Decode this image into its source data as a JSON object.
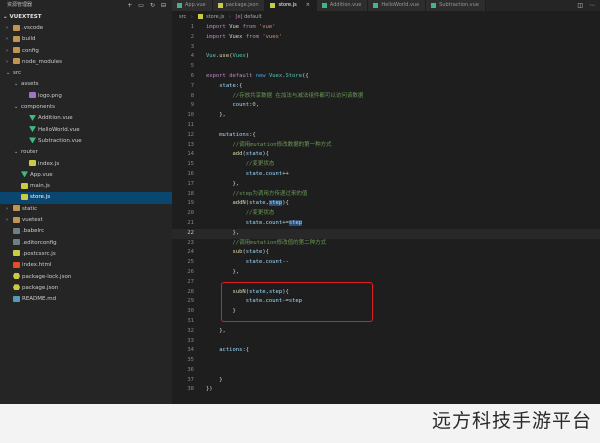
{
  "sidebar": {
    "title": "资源管理器",
    "project": "VUEXTEST",
    "tree": [
      {
        "label": ".vscode",
        "indent": 1,
        "arrow": "›",
        "icon": "folder"
      },
      {
        "label": "build",
        "indent": 1,
        "arrow": "›",
        "icon": "folder"
      },
      {
        "label": "config",
        "indent": 1,
        "arrow": "›",
        "icon": "folder"
      },
      {
        "label": "node_modules",
        "indent": 1,
        "arrow": "›",
        "icon": "folder"
      },
      {
        "label": "src",
        "indent": 1,
        "arrow": "⌄",
        "icon": "none"
      },
      {
        "label": "assets",
        "indent": 2,
        "arrow": "⌄",
        "icon": "none"
      },
      {
        "label": "logo.png",
        "indent": 3,
        "arrow": "",
        "icon": "img"
      },
      {
        "label": "components",
        "indent": 2,
        "arrow": "⌄",
        "icon": "none"
      },
      {
        "label": "Addition.vue",
        "indent": 3,
        "arrow": "",
        "icon": "vue"
      },
      {
        "label": "HelloWorld.vue",
        "indent": 3,
        "arrow": "",
        "icon": "vue"
      },
      {
        "label": "Subtraction.vue",
        "indent": 3,
        "arrow": "",
        "icon": "vue"
      },
      {
        "label": "router",
        "indent": 2,
        "arrow": "⌄",
        "icon": "none"
      },
      {
        "label": "index.js",
        "indent": 3,
        "arrow": "",
        "icon": "js"
      },
      {
        "label": "App.vue",
        "indent": 2,
        "arrow": "",
        "icon": "vue"
      },
      {
        "label": "main.js",
        "indent": 2,
        "arrow": "",
        "icon": "js"
      },
      {
        "label": "store.js",
        "indent": 2,
        "arrow": "",
        "icon": "js",
        "selected": true
      },
      {
        "label": "static",
        "indent": 1,
        "arrow": "›",
        "icon": "folder"
      },
      {
        "label": "vuetest",
        "indent": 1,
        "arrow": "›",
        "icon": "folder"
      },
      {
        "label": ".babelrc",
        "indent": 1,
        "arrow": "",
        "icon": "cfg"
      },
      {
        "label": ".editorconfig",
        "indent": 1,
        "arrow": "",
        "icon": "cfg"
      },
      {
        "label": ".postcssrc.js",
        "indent": 1,
        "arrow": "",
        "icon": "js"
      },
      {
        "label": "index.html",
        "indent": 1,
        "arrow": "",
        "icon": "git"
      },
      {
        "label": "package-lock.json",
        "indent": 1,
        "arrow": "",
        "icon": "json"
      },
      {
        "label": "package.json",
        "indent": 1,
        "arrow": "",
        "icon": "json"
      },
      {
        "label": "README.md",
        "indent": 1,
        "arrow": "",
        "icon": "md"
      }
    ]
  },
  "tabs": [
    {
      "label": "App.vue",
      "icon": "vue"
    },
    {
      "label": "package.json",
      "icon": "json"
    },
    {
      "label": "store.js",
      "icon": "js",
      "active": true
    },
    {
      "label": "Addition.vue",
      "icon": "vue"
    },
    {
      "label": "HelloWorld.vue",
      "icon": "vue"
    },
    {
      "label": "Subtraction.vue",
      "icon": "vue"
    }
  ],
  "breadcrumb": [
    "src",
    "store.js",
    "default"
  ],
  "code": {
    "current_line": 22,
    "lines": [
      [
        [
          "kw",
          "import "
        ],
        [
          "pn",
          "Vue "
        ],
        [
          "kw",
          "from "
        ],
        [
          "str",
          "'vue'"
        ]
      ],
      [
        [
          "kw",
          "import "
        ],
        [
          "pn",
          "Vuex "
        ],
        [
          "kw",
          "from "
        ],
        [
          "str",
          "'vuex'"
        ]
      ],
      [],
      [
        [
          "cls",
          "Vue"
        ],
        [
          "pn",
          "."
        ],
        [
          "fn",
          "use"
        ],
        [
          "pn",
          "("
        ],
        [
          "cls",
          "Vuex"
        ],
        [
          "pn",
          ")"
        ]
      ],
      [],
      [
        [
          "kw",
          "export "
        ],
        [
          "kw",
          "default "
        ],
        [
          "kb",
          "new "
        ],
        [
          "cls",
          "Vuex"
        ],
        [
          "pn",
          "."
        ],
        [
          "cls",
          "Store"
        ],
        [
          "pn",
          "({"
        ]
      ],
      [
        [
          "pn",
          "    "
        ],
        [
          "var",
          "state"
        ],
        [
          "pn",
          ":{"
        ]
      ],
      [
        [
          "pn",
          "        "
        ],
        [
          "cm",
          "//存放共享数据 在加法与减法组件都可以访问该数据"
        ]
      ],
      [
        [
          "pn",
          "        "
        ],
        [
          "var",
          "count"
        ],
        [
          "pn",
          ":"
        ],
        [
          "num",
          "0"
        ],
        [
          "pn",
          ","
        ]
      ],
      [
        [
          "pn",
          "    "
        ],
        [
          "pn",
          "},"
        ]
      ],
      [],
      [
        [
          "pn",
          "    "
        ],
        [
          "var",
          "mutations"
        ],
        [
          "pn",
          ":{"
        ]
      ],
      [
        [
          "pn",
          "        "
        ],
        [
          "cm",
          "//调用mutation修改数据的第一种方式"
        ]
      ],
      [
        [
          "pn",
          "        "
        ],
        [
          "fn",
          "add"
        ],
        [
          "pn",
          "("
        ],
        [
          "var",
          "state"
        ],
        [
          "pn",
          "){"
        ]
      ],
      [
        [
          "pn",
          "            "
        ],
        [
          "cm",
          "//变更状态"
        ]
      ],
      [
        [
          "pn",
          "            "
        ],
        [
          "var",
          "state"
        ],
        [
          "pn",
          "."
        ],
        [
          "var",
          "count"
        ],
        [
          "pn",
          "++"
        ]
      ],
      [
        [
          "pn",
          "        "
        ],
        [
          "pn",
          "},"
        ]
      ],
      [
        [
          "pn",
          "        "
        ],
        [
          "cm",
          "//step为调用方传递过来的值"
        ]
      ],
      [
        [
          "pn",
          "        "
        ],
        [
          "fn",
          "addN"
        ],
        [
          "pn",
          "("
        ],
        [
          "var",
          "state"
        ],
        [
          "pn",
          ","
        ],
        [
          "hl",
          "step"
        ],
        [
          "pn",
          "){"
        ]
      ],
      [
        [
          "pn",
          "            "
        ],
        [
          "cm",
          "//变更状态"
        ]
      ],
      [
        [
          "pn",
          "            "
        ],
        [
          "var",
          "state"
        ],
        [
          "pn",
          "."
        ],
        [
          "var",
          "count"
        ],
        [
          "pn",
          "+="
        ],
        [
          "hl",
          "step"
        ]
      ],
      [
        [
          "pn",
          "        "
        ],
        [
          "pn",
          "},"
        ]
      ],
      [
        [
          "pn",
          "        "
        ],
        [
          "cm",
          "//调用mutation修改值的第二种方式"
        ]
      ],
      [
        [
          "pn",
          "        "
        ],
        [
          "fn",
          "sub"
        ],
        [
          "pn",
          "("
        ],
        [
          "var",
          "state"
        ],
        [
          "pn",
          "){"
        ]
      ],
      [
        [
          "pn",
          "            "
        ],
        [
          "var",
          "state"
        ],
        [
          "pn",
          "."
        ],
        [
          "var",
          "count"
        ],
        [
          "pn",
          "--"
        ]
      ],
      [
        [
          "pn",
          "        "
        ],
        [
          "pn",
          "},"
        ]
      ],
      [],
      [
        [
          "pn",
          "        "
        ],
        [
          "fn",
          "subN"
        ],
        [
          "pn",
          "("
        ],
        [
          "var",
          "state"
        ],
        [
          "pn",
          ","
        ],
        [
          "var",
          "step"
        ],
        [
          "pn",
          "){"
        ]
      ],
      [
        [
          "pn",
          "            "
        ],
        [
          "var",
          "state"
        ],
        [
          "pn",
          "."
        ],
        [
          "var",
          "count"
        ],
        [
          "pn",
          "-="
        ],
        [
          "var",
          "step"
        ]
      ],
      [
        [
          "pn",
          "        "
        ],
        [
          "pn",
          "}"
        ]
      ],
      [],
      [
        [
          "pn",
          "    "
        ],
        [
          "pn",
          "},"
        ]
      ],
      [],
      [
        [
          "pn",
          "    "
        ],
        [
          "var",
          "actions"
        ],
        [
          "pn",
          ":{"
        ]
      ],
      [],
      [],
      [
        [
          "pn",
          "    "
        ],
        [
          "pn",
          "}"
        ]
      ],
      [
        [
          "pn",
          "})"
        ]
      ]
    ]
  },
  "watermark": "远方科技手游平台"
}
